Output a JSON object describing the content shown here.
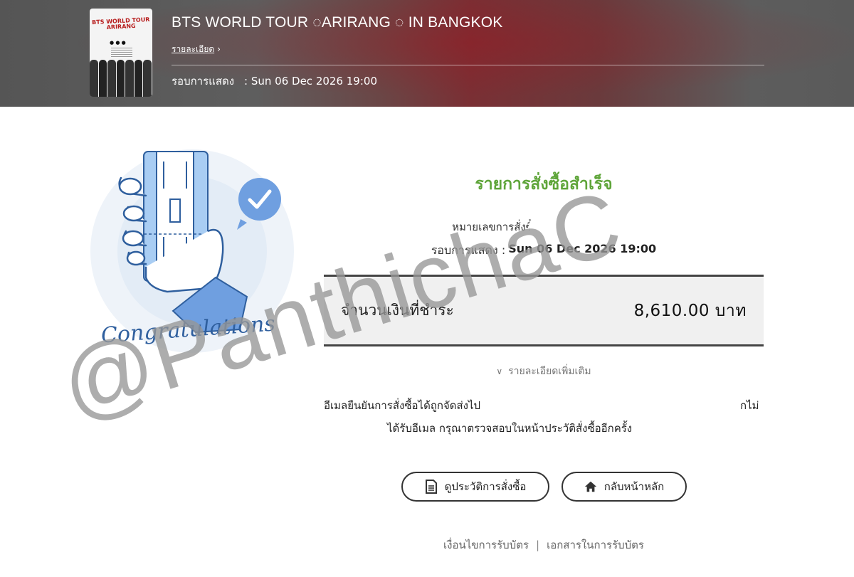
{
  "header": {
    "event_title": "BTS WORLD TOUR ◌ARIRANG ◌ IN BANGKOK",
    "detail_link": "รายละเอียด",
    "round_label": "รอบการแสดง",
    "round_value": ": Sun 06 Dec 2026 19:00",
    "poster_title": "BTS WORLD TOUR ARIRANG"
  },
  "illustration": {
    "caption": "Congratulations",
    "check_badge_icon": "check-icon"
  },
  "result": {
    "title": "รายการสั่งซื้อสำเร็จ",
    "order_label": "หมายเลขการสั่งซื้",
    "round_label": "รอบการแสดง :",
    "round_value": "Sun 06 Dec 2026 19:00",
    "amount_label": "จำนวนเงินที่ชำระ",
    "amount_value": "8,610.00 บาท",
    "more_details": "รายละเอียดเพิ่มเติม",
    "email_line1": "อีเมลยืนยันการสั่งซื้อได้ถูกจัดส่งไป",
    "email_line1_end": "กไม่",
    "email_line2": "ได้รับอีเมล กรุณาตรวจสอบในหน้าประวัติสั่งซื้ออีกครั้ง"
  },
  "buttons": {
    "history": "ดูประวัติการสั่งซื้อ",
    "home": "กลับหน้าหลัก"
  },
  "footer": {
    "terms": "เงื่อนไขการรับบัตร",
    "docs": "เอกสารในการรับบัตร"
  },
  "watermark": "@PanthichaC",
  "colors": {
    "success_green": "#5fa53a",
    "illustration_blue": "#2f5f9e",
    "card_blue": "#a9cdf3"
  }
}
